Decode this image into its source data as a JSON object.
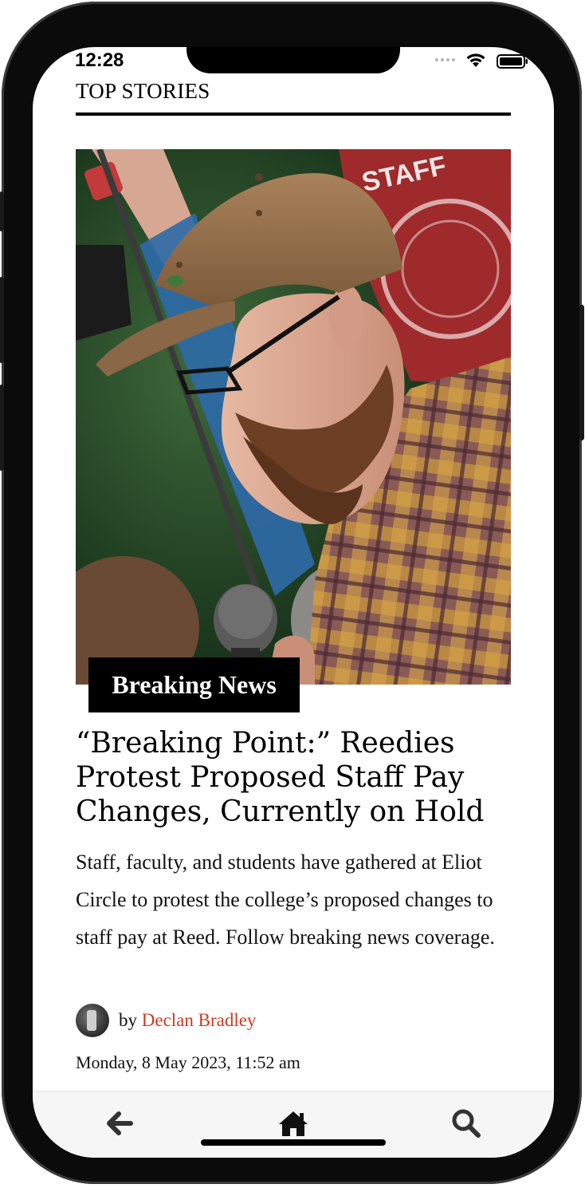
{
  "status_bar": {
    "time": "12:28"
  },
  "section": {
    "title": "TOP STORIES"
  },
  "article": {
    "badge": "Breaking News",
    "headline": "“Breaking Point:” Reedies Protest Proposed Staff Pay Changes, Currently on Hold",
    "summary": "Staff, faculty, and students have gathered at Eliot Circle to protest the college’s proposed changes to staff pay at Reed. Follow breaking news coverage.",
    "byline_prefix": "by",
    "author": "Declan Bradley",
    "date": "Monday, 8 May 2023, 11:52 am",
    "image_sign_text": "STAFF"
  },
  "tabbar": {
    "back_icon": "arrow-left-icon",
    "home_icon": "home-icon",
    "search_icon": "search-icon"
  },
  "colors": {
    "author_link": "#d0381f",
    "badge_bg": "#000000",
    "sign_red": "#9e2a2b"
  }
}
